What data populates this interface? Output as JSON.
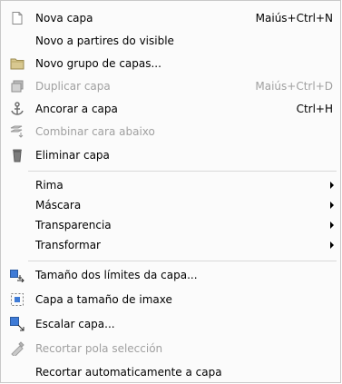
{
  "menu": {
    "items": [
      {
        "id": "nova-capa",
        "label": "Nova capa",
        "shortcut": "Maiús+Ctrl+N",
        "disabled": false,
        "icon": "new-layer-icon"
      },
      {
        "id": "novo-a-partires-visible",
        "label": "Novo a partires do visible",
        "shortcut": "",
        "disabled": false,
        "icon": ""
      },
      {
        "id": "novo-grupo",
        "label": "Novo grupo de capas...",
        "shortcut": "",
        "disabled": false,
        "icon": "folder-icon"
      },
      {
        "id": "duplicar",
        "label": "Duplicar capa",
        "shortcut": "Maiús+Ctrl+D",
        "disabled": true,
        "icon": "duplicate-layer-icon"
      },
      {
        "id": "ancorar",
        "label": "Ancorar a capa",
        "shortcut": "Ctrl+H",
        "disabled": false,
        "icon": "anchor-icon"
      },
      {
        "id": "combinar",
        "label": "Combinar cara abaixo",
        "shortcut": "",
        "disabled": true,
        "icon": "merge-down-icon"
      },
      {
        "id": "eliminar",
        "label": "Eliminar capa",
        "shortcut": "",
        "disabled": false,
        "icon": "delete-layer-icon"
      },
      {
        "id": "rima",
        "label": "Rima",
        "submenu": true
      },
      {
        "id": "mascara",
        "label": "Máscara",
        "submenu": true
      },
      {
        "id": "transparencia",
        "label": "Transparencia",
        "submenu": true
      },
      {
        "id": "transformar",
        "label": "Transformar",
        "submenu": true
      },
      {
        "id": "tamano-limites",
        "label": "Tamaño dos límites da capa...",
        "disabled": false,
        "icon": "layer-boundary-size-icon"
      },
      {
        "id": "capa-tamano-imaxe",
        "label": "Capa a tamaño de imaxe",
        "disabled": false,
        "icon": "layer-to-image-size-icon"
      },
      {
        "id": "escalar",
        "label": "Escalar capa...",
        "disabled": false,
        "icon": "scale-layer-icon"
      },
      {
        "id": "recortar-seleccion",
        "label": "Recortar pola selección",
        "disabled": true,
        "icon": "crop-icon"
      },
      {
        "id": "recortar-auto",
        "label": "Recortar automaticamente a capa",
        "disabled": false,
        "icon": ""
      }
    ]
  }
}
